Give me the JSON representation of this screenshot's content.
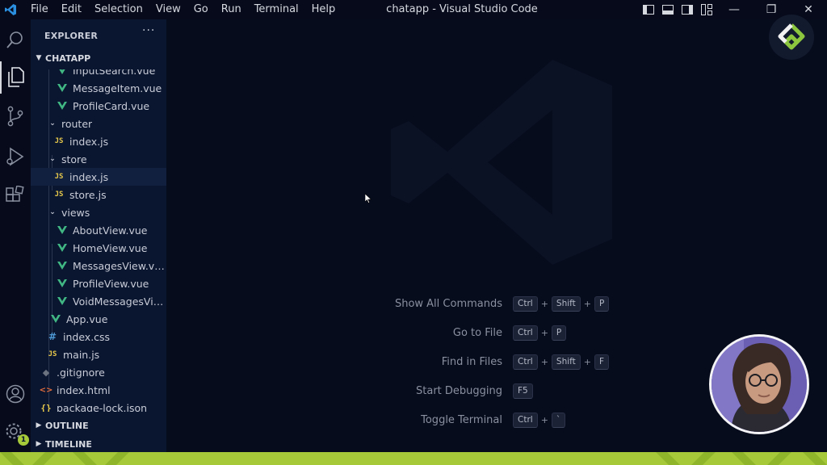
{
  "window": {
    "title": "chatapp - Visual Studio Code"
  },
  "menu": [
    {
      "label": "File"
    },
    {
      "label": "Edit"
    },
    {
      "label": "Selection"
    },
    {
      "label": "View"
    },
    {
      "label": "Go"
    },
    {
      "label": "Run"
    },
    {
      "label": "Terminal"
    },
    {
      "label": "Help"
    }
  ],
  "window_controls": {
    "minimize": "—",
    "restore": "❐",
    "close": "✕"
  },
  "icons": {
    "app": "vscode-icon",
    "activity": [
      "search-icon",
      "explorer-icon",
      "source-control-icon",
      "run-debug-icon",
      "extensions-icon",
      "account-icon",
      "settings-gear-icon"
    ],
    "brand": "brand-logo-icon"
  },
  "activity": {
    "settings_badge": "1"
  },
  "sidebar": {
    "title": "EXPLORER",
    "more": "···",
    "root": "CHATAPP",
    "tree": [
      {
        "label": "InputSearch.vue",
        "type": "vue"
      },
      {
        "label": "MessageItem.vue",
        "type": "vue"
      },
      {
        "label": "ProfileCard.vue",
        "type": "vue"
      },
      {
        "label": "router",
        "type": "folder"
      },
      {
        "label": "index.js",
        "type": "js"
      },
      {
        "label": "store",
        "type": "folder"
      },
      {
        "label": "index.js",
        "type": "js"
      },
      {
        "label": "store.js",
        "type": "js"
      },
      {
        "label": "views",
        "type": "folder"
      },
      {
        "label": "AboutView.vue",
        "type": "vue"
      },
      {
        "label": "HomeView.vue",
        "type": "vue"
      },
      {
        "label": "MessagesView.vue",
        "type": "vue"
      },
      {
        "label": "ProfileView.vue",
        "type": "vue"
      },
      {
        "label": "VoidMessagesView.vue",
        "type": "vue"
      },
      {
        "label": "App.vue",
        "type": "vue"
      },
      {
        "label": "index.css",
        "type": "css"
      },
      {
        "label": "main.js",
        "type": "js"
      },
      {
        "label": ".gitignore",
        "type": "git"
      },
      {
        "label": "index.html",
        "type": "html"
      },
      {
        "label": "package-lock.json",
        "type": "json"
      }
    ],
    "outline": "OUTLINE",
    "timeline": "TIMELINE"
  },
  "editor": {
    "shortcuts": [
      {
        "label": "Show All Commands",
        "keys": [
          "Ctrl",
          "Shift",
          "P"
        ]
      },
      {
        "label": "Go to File",
        "keys": [
          "Ctrl",
          "P"
        ]
      },
      {
        "label": "Find in Files",
        "keys": [
          "Ctrl",
          "Shift",
          "F"
        ]
      },
      {
        "label": "Start Debugging",
        "keys": [
          "F5"
        ]
      },
      {
        "label": "Toggle Terminal",
        "keys": [
          "Ctrl",
          "`"
        ]
      }
    ],
    "key_separator": "+"
  },
  "colors": {
    "accent_band": "#a6c93a",
    "vue_green": "#41b883",
    "brand_green": "#8cc63f"
  }
}
